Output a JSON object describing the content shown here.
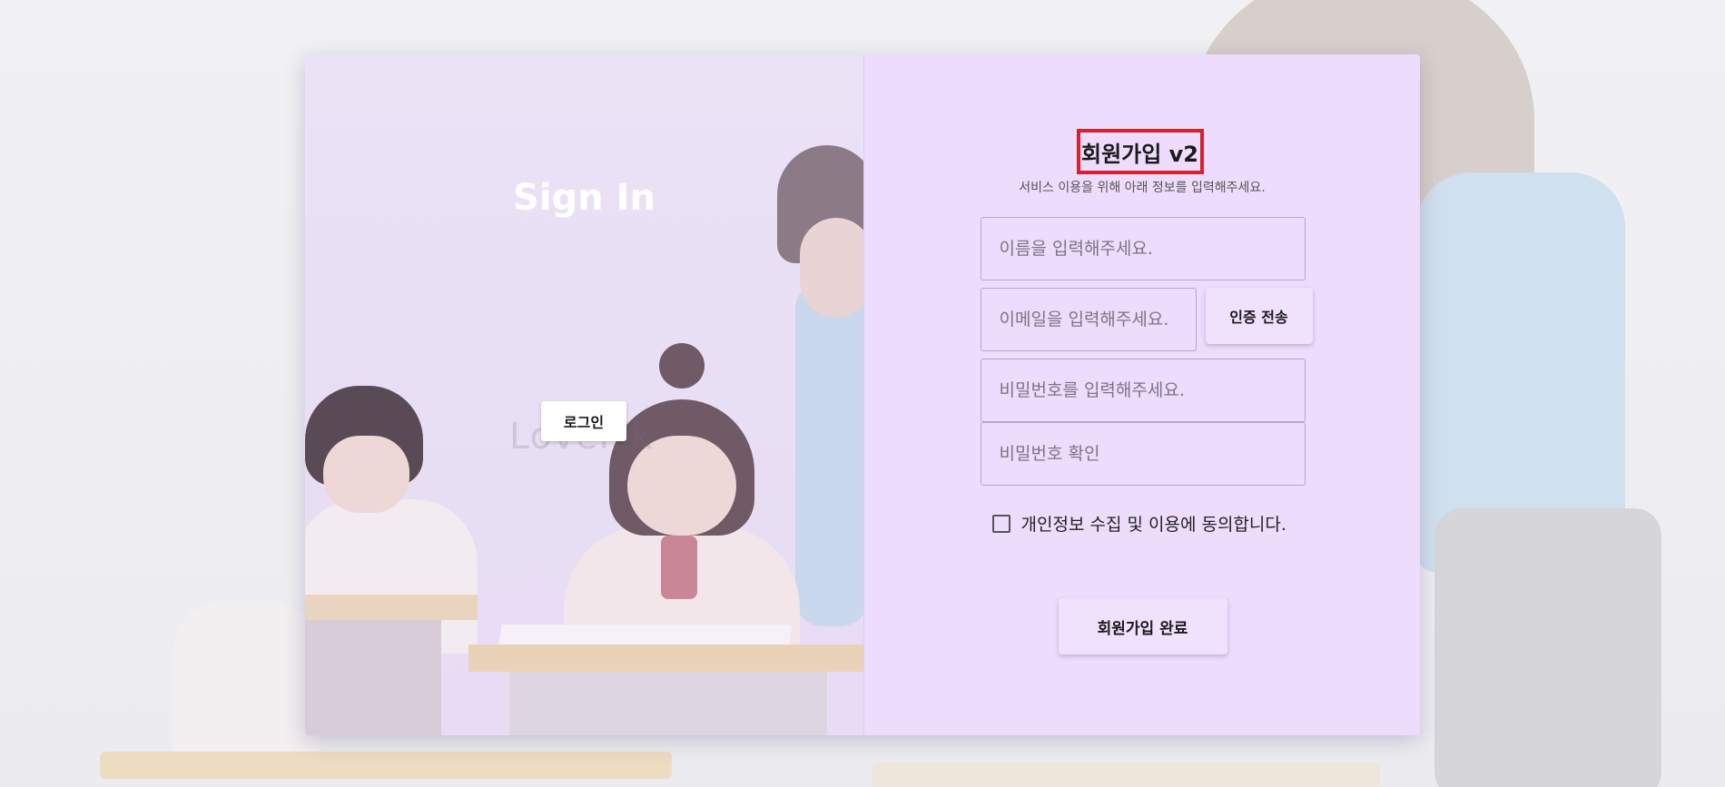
{
  "left_panel": {
    "title": "Sign In",
    "login_button_label": "로그인",
    "watermark": "LovePik"
  },
  "signup_form": {
    "title": "회원가입 v2",
    "subtitle": "서비스 이용을 위해 아래 정보를 입력해주세요.",
    "name_placeholder": "이름을 입력해주세요.",
    "email_placeholder": "이메일을 입력해주세요.",
    "verify_button_label": "인증 전송",
    "password_placeholder": "비밀번호를 입력해주세요.",
    "password_confirm_placeholder": "비밀번호 확인",
    "consent_label": "개인정보 수집 및 이용에 동의합니다.",
    "consent_checked": false,
    "submit_button_label": "회원가입 완료"
  },
  "colors": {
    "left_panel_bg": "#e9def6",
    "right_panel_bg": "#eedcfc",
    "title_highlight_border": "#d8202e"
  }
}
